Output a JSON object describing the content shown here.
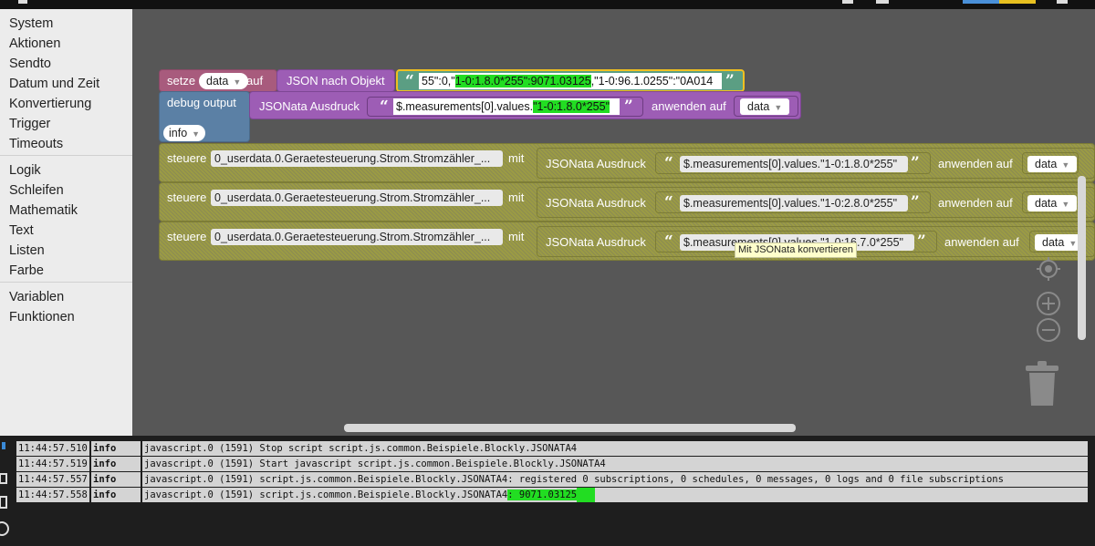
{
  "toolbox": {
    "categories": [
      "System",
      "Aktionen",
      "Sendto",
      "Datum und Zeit",
      "Konvertierung",
      "Trigger",
      "Timeouts",
      "Logik",
      "Schleifen",
      "Mathematik",
      "Text",
      "Listen",
      "Farbe",
      "Variablen",
      "Funktionen"
    ]
  },
  "blocks": {
    "setze": {
      "label": "setze",
      "variable": "data",
      "auf": "auf"
    },
    "json_parse": {
      "label": "JSON nach Objekt"
    },
    "json_string": {
      "pre": "55\":0,\"",
      "highlight": "1-0:1.8.0*255\":9071.03125",
      "post": ",\"1-0:96.1.0255\":\"0A014"
    },
    "debug": {
      "label": "debug output",
      "level": "info"
    },
    "debug_jsonata": {
      "label": "JSONata Ausdruck",
      "expr_pre": "$.measurements[0].values.",
      "expr_highlight": "\"1-0:1.8.0*255\"",
      "apply": "anwenden auf",
      "target": "data"
    },
    "steuere": [
      {
        "label": "steuere",
        "state": "0_userdata.0.Geraetesteuerung.Strom.Stromzähler_...",
        "mit": "mit",
        "jsonata": "JSONata Ausdruck",
        "expr": "$.measurements[0].values.\"1-0:1.8.0*255\"",
        "apply": "anwenden auf",
        "target": "data"
      },
      {
        "label": "steuere",
        "state": "0_userdata.0.Geraetesteuerung.Strom.Stromzähler_...",
        "mit": "mit",
        "jsonata": "JSONata Ausdruck",
        "expr": "$.measurements[0].values.\"1-0:2.8.0*255\"",
        "apply": "anwenden auf",
        "target": "data"
      },
      {
        "label": "steuere",
        "state": "0_userdata.0.Geraetesteuerung.Strom.Stromzähler_...",
        "mit": "mit",
        "jsonata": "JSONata Ausdruck",
        "expr": "$.measurements[0].values.\"1-0:16.7.0*255\"",
        "apply": "anwenden auf",
        "target": "data"
      }
    ],
    "quote_open": "“",
    "quote_close": "”",
    "arrow": "▼"
  },
  "tooltip": "Mit JSONata konvertieren",
  "log": [
    {
      "time": "11:44:57.510",
      "level": "info",
      "message": "javascript.0 (1591) Stop script script.js.common.Beispiele.Blockly.JSONATA4"
    },
    {
      "time": "11:44:57.519",
      "level": "info",
      "message": "javascript.0 (1591) Start javascript script.js.common.Beispiele.Blockly.JSONATA4"
    },
    {
      "time": "11:44:57.557",
      "level": "info",
      "message": "javascript.0 (1591) script.js.common.Beispiele.Blockly.JSONATA4: registered 0 subscriptions, 0 schedules, 0 messages, 0 logs and 0 file subscriptions"
    },
    {
      "time": "11:44:57.558",
      "level": "info",
      "message": "javascript.0 (1591) script.js.common.Beispiele.Blockly.JSONATA4",
      "highlight": ": 9071.03125"
    }
  ],
  "colors": {
    "toolbox_bg": "#ececec",
    "workspace_bg": "#575757",
    "highlight": "#22dd22",
    "steuere_block": "#9b9b44",
    "jsonata_block": "#9d5db5",
    "setze_block": "#a85b7d",
    "debug_block": "#5b80a5",
    "json_block": "#5b9e83"
  },
  "icons": [
    "target-icon",
    "zoom-in-icon",
    "zoom-out-icon",
    "trash-icon"
  ]
}
